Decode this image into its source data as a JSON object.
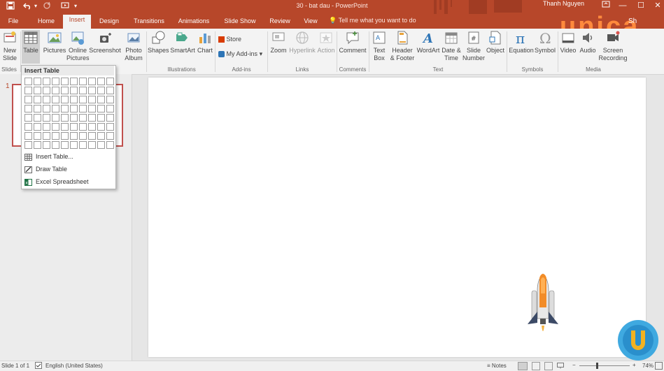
{
  "qat": {
    "save_icon": "save-icon",
    "undo_icon": "undo-icon",
    "redo_icon": "redo-icon",
    "customize_icon": "customize-qat-icon"
  },
  "window": {
    "title": "30 - bat dau  -  PowerPoint",
    "user": "Thanh Nguyen",
    "minimize": "—",
    "maximize": "☐",
    "close": "✕"
  },
  "tabs": [
    "File",
    "Home",
    "Insert",
    "Design",
    "Transitions",
    "Animations",
    "Slide Show",
    "Review",
    "View"
  ],
  "tell_me": "Tell me what you want to do",
  "brand": {
    "logo_text": "unica",
    "share_text": "Sh",
    "color": "#ff8a3d"
  },
  "ribbon": {
    "slides": {
      "new_slide": "New\nSlide",
      "group": "Slides"
    },
    "tables": {
      "table": "Table"
    },
    "images": {
      "pictures": "Pictures",
      "online_pictures": "Online\nPictures",
      "screenshot": "Screenshot",
      "photo_album": "Photo\nAlbum"
    },
    "illustrations": {
      "shapes": "Shapes",
      "smartart": "SmartArt",
      "chart": "Chart",
      "group": "Illustrations"
    },
    "addins": {
      "store": "Store",
      "my_addins": "My Add-ins",
      "group": "Add-ins"
    },
    "links": {
      "zoom": "Zoom",
      "hyperlink": "Hyperlink",
      "action": "Action",
      "group": "Links"
    },
    "comments": {
      "comment": "Comment",
      "group": "Comments"
    },
    "text": {
      "text_box": "Text\nBox",
      "header_footer": "Header\n& Footer",
      "wordart": "WordArt",
      "date_time": "Date &\nTime",
      "slide_number": "Slide\nNumber",
      "object": "Object",
      "group": "Text"
    },
    "symbols": {
      "equation": "Equation",
      "symbol": "Symbol",
      "group": "Symbols"
    },
    "media": {
      "video": "Video",
      "audio": "Audio",
      "screen_recording": "Screen\nRecording",
      "group": "Media"
    }
  },
  "insert_table_menu": {
    "header": "Insert Table",
    "grid": {
      "columns": 10,
      "rows": 8
    },
    "items": [
      {
        "label": "Insert Table...",
        "icon": "table-icon"
      },
      {
        "label": "Draw Table",
        "icon": "draw-table-icon"
      },
      {
        "label": "Excel Spreadsheet",
        "icon": "excel-icon"
      }
    ]
  },
  "slide_panel": {
    "slide_number": "1"
  },
  "status": {
    "slide_info": "Slide 1 of 1",
    "language": "English (United States)",
    "notes": "Notes",
    "zoom": "74%"
  },
  "colors": {
    "accent": "#b7472a",
    "ribbon_bg": "#f3f3f3",
    "workspace_bg": "#e6e6e6"
  }
}
